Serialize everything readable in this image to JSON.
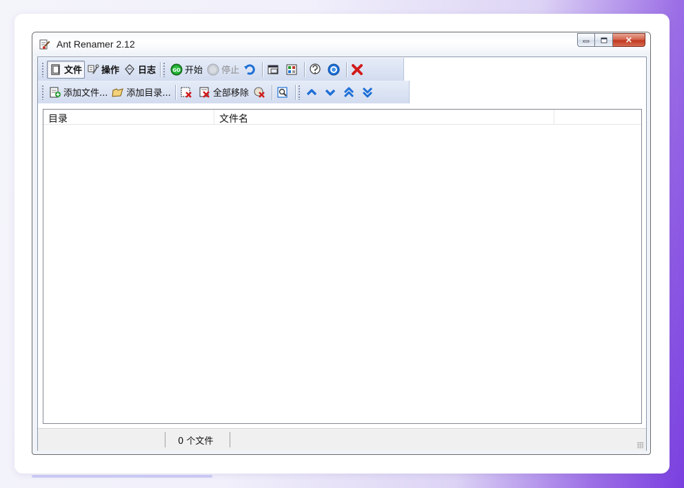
{
  "window": {
    "title": "Ant Renamer 2.12",
    "buttons": {
      "minimize": "minimize",
      "maximize": "maximize",
      "close": "×"
    }
  },
  "toolbar1": {
    "files_label": "文件",
    "actions_label": "操作",
    "log_label": "日志",
    "start_label": "开始",
    "stop_label": "停止"
  },
  "toolbar2": {
    "add_files_label": "添加文件...",
    "add_folder_label": "添加目录...",
    "remove_all_label": "全部移除"
  },
  "list": {
    "columns": [
      "目录",
      "文件名",
      ""
    ]
  },
  "statusbar": {
    "panel1": "",
    "file_count": "0 个文件"
  },
  "colors": {
    "toolbar_bg": "#d2dcef",
    "close_button": "#c0391f",
    "nav_arrows": "#1d6fd6"
  }
}
